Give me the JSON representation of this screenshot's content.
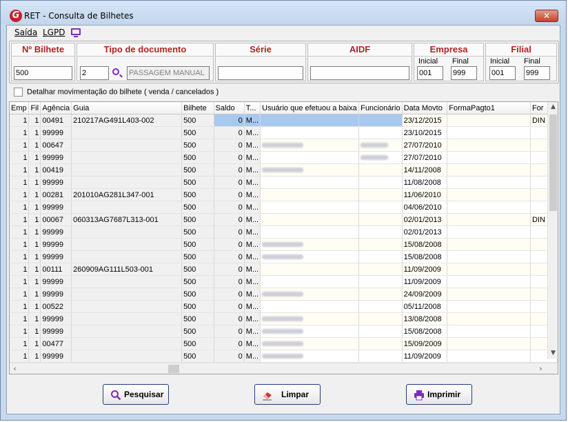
{
  "window": {
    "title": "RET - Consulta de Bilhetes",
    "icon_letter": "G",
    "close_glyph": "✕"
  },
  "menu": {
    "saida": "Saída",
    "lgpd": "LGPD"
  },
  "filters": {
    "bilhete": {
      "label": "Nº Bilhete",
      "value": "500"
    },
    "tipo": {
      "label": "Tipo de documento",
      "code": "2",
      "description": "PASSAGEM MANUAL"
    },
    "serie": {
      "label": "Série",
      "value": ""
    },
    "aidf": {
      "label": "AIDF",
      "value": ""
    },
    "empresa": {
      "label": "Empresa",
      "inicial_label": "Inicial",
      "final_label": "Final",
      "inicial": "001",
      "final": "999"
    },
    "filial": {
      "label": "Filial",
      "inicial_label": "Inicial",
      "final_label": "Final",
      "inicial": "001",
      "final": "999"
    }
  },
  "detail_checkbox": {
    "label": "Detalhar movimentação do bilhete ( venda / cancelados )",
    "checked": false
  },
  "grid": {
    "columns": [
      "Emp",
      "Fil",
      "Agência",
      "Guia",
      "Bilhete",
      "Saldo",
      "T...",
      "Usuário que efetuou a baixa",
      "Funcionário",
      "Data Movto",
      "FormaPagto1",
      "For"
    ],
    "rows": [
      {
        "emp": "1",
        "fil": "1",
        "agencia": "00491",
        "guia": "210217AG491L403-002",
        "bilhete": "500",
        "saldo": "0",
        "t": "M...",
        "data": "23/12/2015",
        "forma2": "DIN",
        "user_blur": false,
        "func_blur": false,
        "selected": true
      },
      {
        "emp": "1",
        "fil": "1",
        "agencia": "99999",
        "guia": "",
        "bilhete": "500",
        "saldo": "0",
        "t": "M...",
        "data": "23/10/2015",
        "forma2": "",
        "user_blur": false,
        "func_blur": false
      },
      {
        "emp": "1",
        "fil": "1",
        "agencia": "00647",
        "guia": "",
        "bilhete": "500",
        "saldo": "0",
        "t": "M...",
        "data": "27/07/2010",
        "forma2": "",
        "user_blur": true,
        "func_blur": true
      },
      {
        "emp": "1",
        "fil": "1",
        "agencia": "99999",
        "guia": "",
        "bilhete": "500",
        "saldo": "0",
        "t": "M...",
        "data": "27/07/2010",
        "forma2": "",
        "user_blur": false,
        "func_blur": true
      },
      {
        "emp": "1",
        "fil": "1",
        "agencia": "00419",
        "guia": "",
        "bilhete": "500",
        "saldo": "0",
        "t": "M...",
        "data": "14/11/2008",
        "forma2": "",
        "user_blur": true,
        "func_blur": false
      },
      {
        "emp": "1",
        "fil": "1",
        "agencia": "99999",
        "guia": "",
        "bilhete": "500",
        "saldo": "0",
        "t": "M...",
        "data": "11/08/2008",
        "forma2": "",
        "user_blur": false,
        "func_blur": false
      },
      {
        "emp": "1",
        "fil": "1",
        "agencia": "00281",
        "guia": "201010AG281L347-001",
        "bilhete": "500",
        "saldo": "0",
        "t": "M...",
        "data": "11/06/2010",
        "forma2": "",
        "user_blur": false,
        "func_blur": false
      },
      {
        "emp": "1",
        "fil": "1",
        "agencia": "99999",
        "guia": "",
        "bilhete": "500",
        "saldo": "0",
        "t": "M...",
        "data": "04/06/2010",
        "forma2": "",
        "user_blur": false,
        "func_blur": false
      },
      {
        "emp": "1",
        "fil": "1",
        "agencia": "00067",
        "guia": "060313AG7687L313-001",
        "bilhete": "500",
        "saldo": "0",
        "t": "M...",
        "data": "02/01/2013",
        "forma2": "DIN",
        "user_blur": false,
        "func_blur": false
      },
      {
        "emp": "1",
        "fil": "1",
        "agencia": "99999",
        "guia": "",
        "bilhete": "500",
        "saldo": "0",
        "t": "M...",
        "data": "02/01/2013",
        "forma2": "",
        "user_blur": false,
        "func_blur": false
      },
      {
        "emp": "1",
        "fil": "1",
        "agencia": "99999",
        "guia": "",
        "bilhete": "500",
        "saldo": "0",
        "t": "M...",
        "data": "15/08/2008",
        "forma2": "",
        "user_blur": true,
        "func_blur": false
      },
      {
        "emp": "1",
        "fil": "1",
        "agencia": "99999",
        "guia": "",
        "bilhete": "500",
        "saldo": "0",
        "t": "M...",
        "data": "15/08/2008",
        "forma2": "",
        "user_blur": true,
        "func_blur": false
      },
      {
        "emp": "1",
        "fil": "1",
        "agencia": "00111",
        "guia": "260909AG111L503-001",
        "bilhete": "500",
        "saldo": "0",
        "t": "M...",
        "data": "11/09/2009",
        "forma2": "",
        "user_blur": false,
        "func_blur": false
      },
      {
        "emp": "1",
        "fil": "1",
        "agencia": "99999",
        "guia": "",
        "bilhete": "500",
        "saldo": "0",
        "t": "M...",
        "data": "11/09/2009",
        "forma2": "",
        "user_blur": false,
        "func_blur": false
      },
      {
        "emp": "1",
        "fil": "1",
        "agencia": "99999",
        "guia": "",
        "bilhete": "500",
        "saldo": "0",
        "t": "M...",
        "data": "24/09/2009",
        "forma2": "",
        "user_blur": true,
        "func_blur": false
      },
      {
        "emp": "1",
        "fil": "1",
        "agencia": "00522",
        "guia": "",
        "bilhete": "500",
        "saldo": "0",
        "t": "M...",
        "data": "05/11/2008",
        "forma2": "",
        "user_blur": false,
        "func_blur": false
      },
      {
        "emp": "1",
        "fil": "1",
        "agencia": "99999",
        "guia": "",
        "bilhete": "500",
        "saldo": "0",
        "t": "M...",
        "data": "13/08/2008",
        "forma2": "",
        "user_blur": true,
        "func_blur": false
      },
      {
        "emp": "1",
        "fil": "1",
        "agencia": "99999",
        "guia": "",
        "bilhete": "500",
        "saldo": "0",
        "t": "M...",
        "data": "15/08/2008",
        "forma2": "",
        "user_blur": true,
        "func_blur": false
      },
      {
        "emp": "1",
        "fil": "1",
        "agencia": "00477",
        "guia": "",
        "bilhete": "500",
        "saldo": "0",
        "t": "M...",
        "data": "15/09/2009",
        "forma2": "",
        "user_blur": true,
        "func_blur": false
      },
      {
        "emp": "1",
        "fil": "1",
        "agencia": "99999",
        "guia": "",
        "bilhete": "500",
        "saldo": "0",
        "t": "M...",
        "data": "11/09/2009",
        "forma2": "",
        "user_blur": true,
        "func_blur": false
      }
    ]
  },
  "buttons": {
    "pesquisar": "Pesquisar",
    "limpar": "Limpar",
    "imprimir": "Imprimir"
  },
  "colors": {
    "accent": "#7b2bbf",
    "header_red": "#b22222",
    "selection": "#a8c8f0"
  }
}
